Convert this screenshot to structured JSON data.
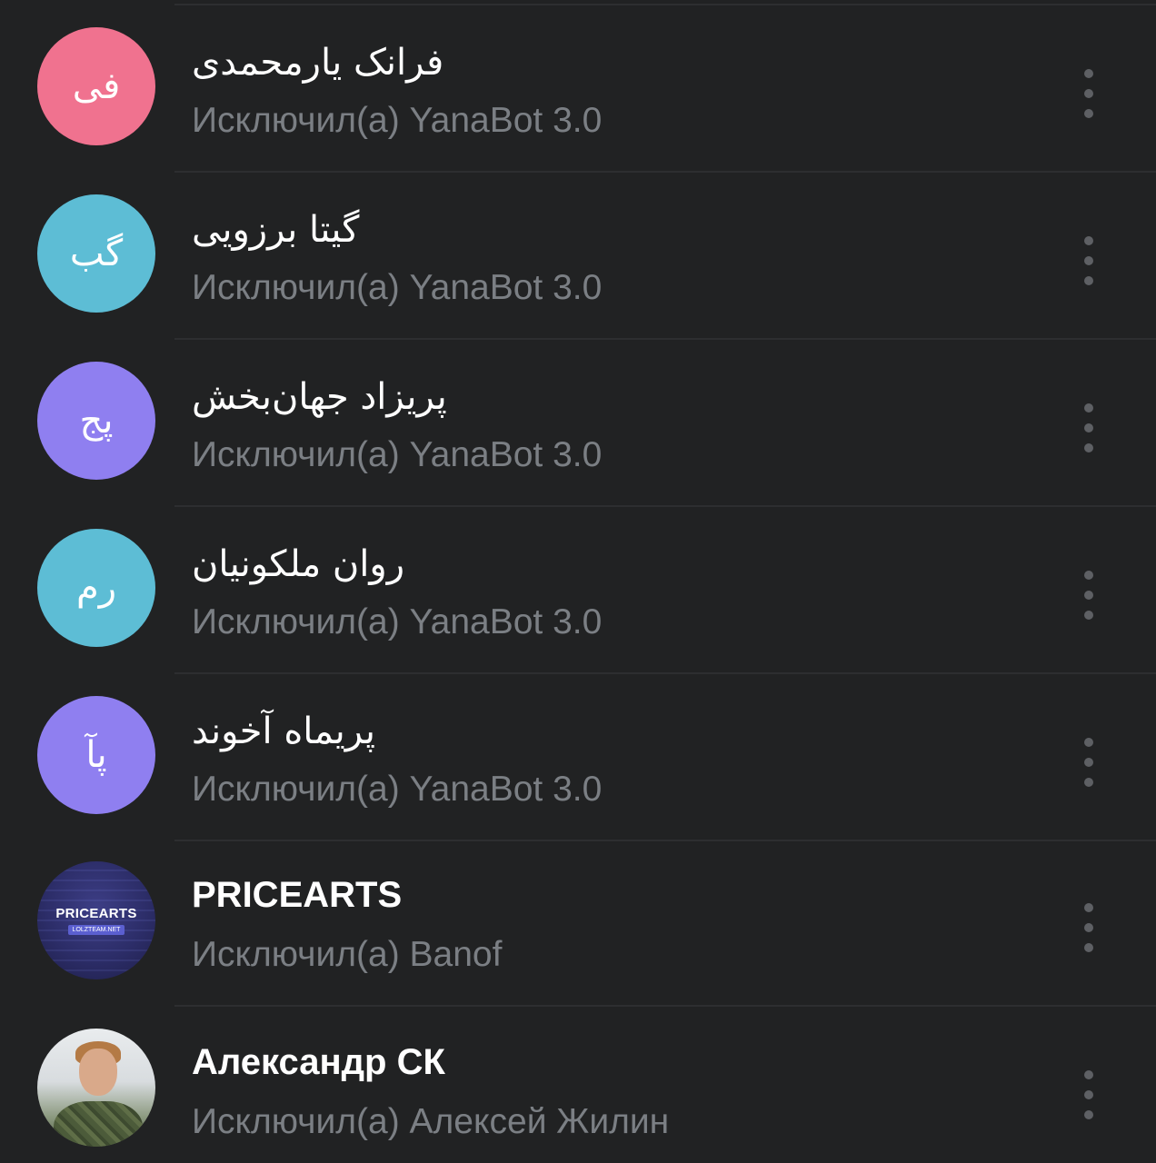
{
  "members": [
    {
      "name": "فرانک یارمحمدی",
      "subtitle": "Исключил(а) YanaBot 3.0",
      "initials": "فی",
      "avatar_color": "#f0728f"
    },
    {
      "name": "گیتا برزویی",
      "subtitle": "Исключил(а) YanaBot 3.0",
      "initials": "گب",
      "avatar_color": "#5dbdd5"
    },
    {
      "name": "پریزاد جهان‌بخش",
      "subtitle": "Исключил(а) YanaBot 3.0",
      "initials": "پج",
      "avatar_color": "#8f7ff0"
    },
    {
      "name": "روان ملکونیان",
      "subtitle": "Исключил(а) YanaBot 3.0",
      "initials": "رم",
      "avatar_color": "#5dbdd5"
    },
    {
      "name": "پریماه آخوند",
      "subtitle": "Исключил(а) YanaBot 3.0",
      "initials": "پآ",
      "avatar_color": "#8f7ff0"
    },
    {
      "name": "PRICEARTS",
      "subtitle": "Исключил(а) Banof",
      "avatar_logo_title": "PRICEARTS",
      "avatar_logo_badge": "LOLZTEAM.NET"
    },
    {
      "name": "Александр СК",
      "subtitle": "Исключил(а) Алексей Жилин",
      "avatar_image": "profile-photo"
    }
  ],
  "colors": {
    "background": "#212223",
    "name_text": "#ffffff",
    "subtitle_text": "#7b7f84",
    "divider": "#2d2e30",
    "menu_dots": "#5e6064"
  },
  "icons": {
    "more": "more-vertical-icon"
  }
}
